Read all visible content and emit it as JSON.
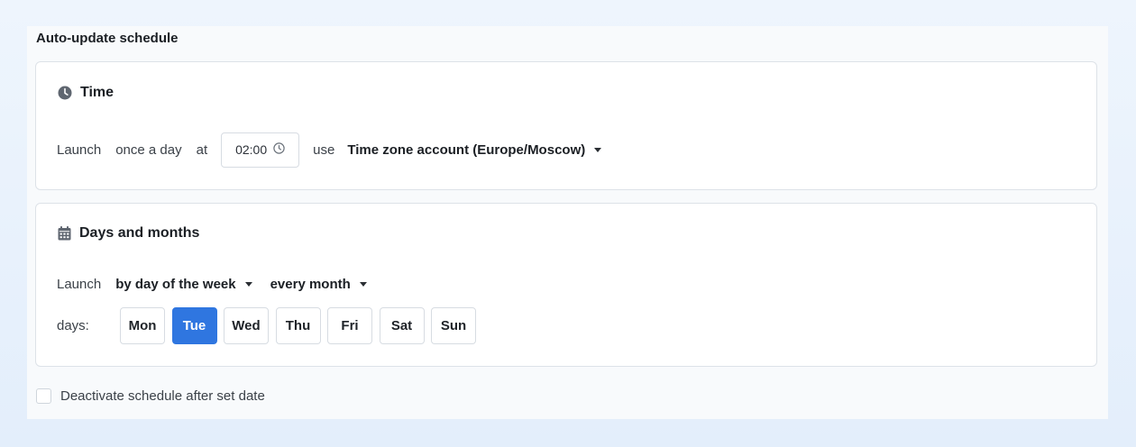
{
  "section_title": "Auto-update schedule",
  "time_card": {
    "title": "Time",
    "icon": "clock-icon",
    "launch_label": "Launch",
    "frequency": "once a day",
    "at_label": "at",
    "time_value": "02:00",
    "use_label": "use",
    "timezone": "Time zone account (Europe/Moscow)"
  },
  "days_card": {
    "title": "Days and months",
    "icon": "calendar-icon",
    "launch_label": "Launch",
    "mode": "by day of the week",
    "period": "every month",
    "days_label": "days:",
    "days": [
      {
        "label": "Mon",
        "selected": false
      },
      {
        "label": "Tue",
        "selected": true
      },
      {
        "label": "Wed",
        "selected": false
      },
      {
        "label": "Thu",
        "selected": false
      },
      {
        "label": "Fri",
        "selected": false
      },
      {
        "label": "Sat",
        "selected": false
      },
      {
        "label": "Sun",
        "selected": false
      }
    ]
  },
  "deactivate": {
    "label": "Deactivate schedule after set date",
    "checked": false
  },
  "colors": {
    "accent": "#2f76e0",
    "border": "#dde2e8"
  }
}
